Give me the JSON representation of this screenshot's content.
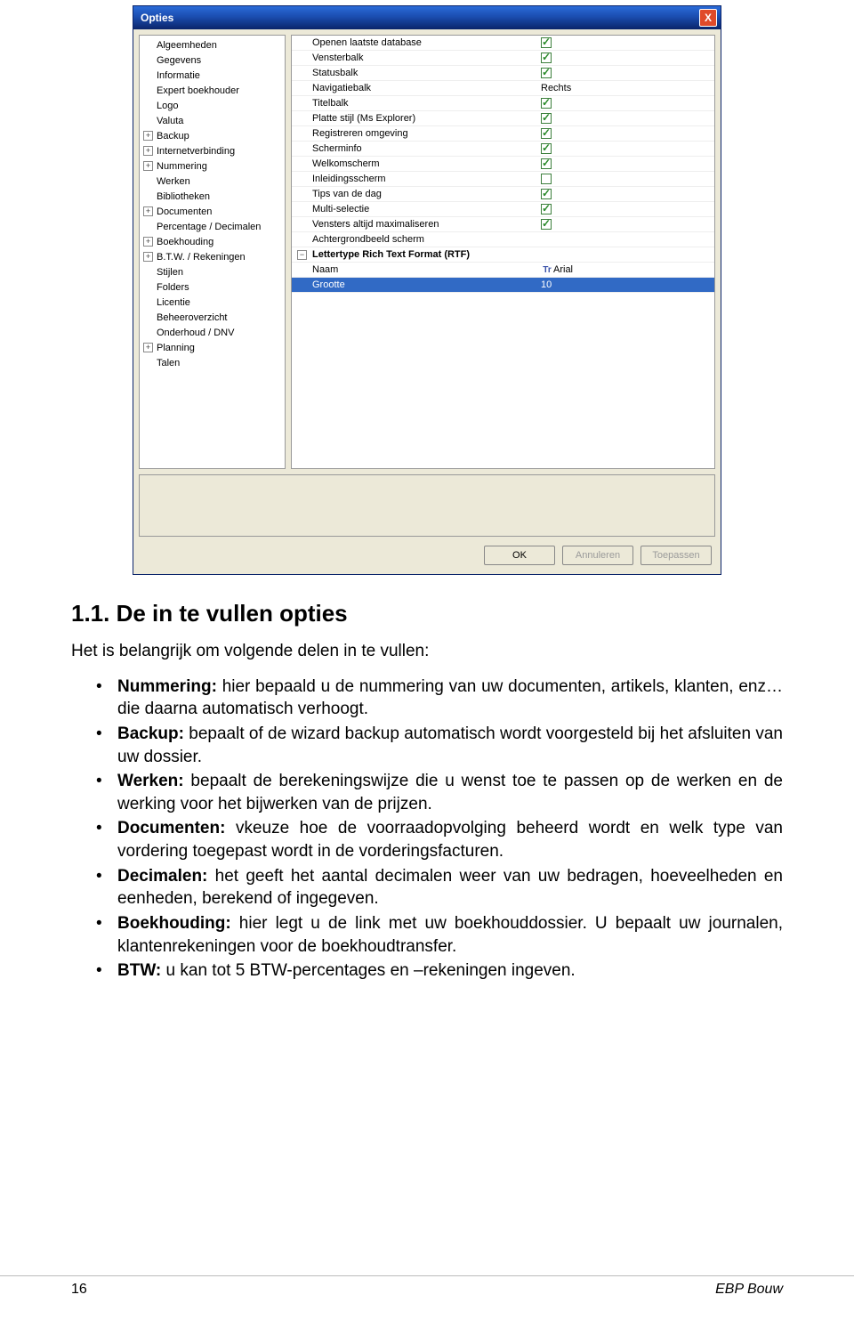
{
  "dialog": {
    "title": "Opties",
    "close": "X",
    "tree": [
      {
        "label": "Algeemheden",
        "expandable": false
      },
      {
        "label": "Gegevens",
        "expandable": false
      },
      {
        "label": "Informatie",
        "expandable": false
      },
      {
        "label": "Expert boekhouder",
        "expandable": false
      },
      {
        "label": "Logo",
        "expandable": false
      },
      {
        "label": "Valuta",
        "expandable": false
      },
      {
        "label": "Backup",
        "expandable": true
      },
      {
        "label": "Internetverbinding",
        "expandable": true
      },
      {
        "label": "Nummering",
        "expandable": true
      },
      {
        "label": "Werken",
        "expandable": false
      },
      {
        "label": "Bibliotheken",
        "expandable": false
      },
      {
        "label": "Documenten",
        "expandable": true
      },
      {
        "label": "Percentage / Decimalen",
        "expandable": false
      },
      {
        "label": "Boekhouding",
        "expandable": true
      },
      {
        "label": "B.T.W. / Rekeningen",
        "expandable": true
      },
      {
        "label": "Stijlen",
        "expandable": false
      },
      {
        "label": "Folders",
        "expandable": false
      },
      {
        "label": "Licentie",
        "expandable": false
      },
      {
        "label": "Beheeroverzicht",
        "expandable": false
      },
      {
        "label": "Onderhoud / DNV",
        "expandable": false
      },
      {
        "label": "Planning",
        "expandable": true
      },
      {
        "label": "Talen",
        "expandable": false
      }
    ],
    "grid": [
      {
        "name": "Openen laatste database",
        "type": "check",
        "checked": true
      },
      {
        "name": "Vensterbalk",
        "type": "check",
        "checked": true
      },
      {
        "name": "Statusbalk",
        "type": "check",
        "checked": true
      },
      {
        "name": "Navigatiebalk",
        "type": "text",
        "value": "Rechts"
      },
      {
        "name": "Titelbalk",
        "type": "check",
        "checked": true
      },
      {
        "name": "Platte stijl (Ms Explorer)",
        "type": "check",
        "checked": true
      },
      {
        "name": "Registreren omgeving",
        "type": "check",
        "checked": true
      },
      {
        "name": "Scherminfo",
        "type": "check",
        "checked": true
      },
      {
        "name": "Welkomscherm",
        "type": "check",
        "checked": true
      },
      {
        "name": "Inleidingsscherm",
        "type": "check",
        "checked": false
      },
      {
        "name": "Tips van de dag",
        "type": "check",
        "checked": true
      },
      {
        "name": "Multi-selectie",
        "type": "check",
        "checked": true
      },
      {
        "name": "Vensters altijd maximaliseren",
        "type": "check",
        "checked": true
      },
      {
        "name": "Achtergrondbeeld scherm",
        "type": "text",
        "value": ""
      }
    ],
    "group_header": "Lettertype Rich Text Format (RTF)",
    "font_rows": [
      {
        "name": "Naam",
        "value": "Arial",
        "icon": "Tr"
      },
      {
        "name": "Grootte",
        "value": "10",
        "selected": true
      }
    ],
    "buttons": {
      "ok": "OK",
      "cancel": "Annuleren",
      "apply": "Toepassen"
    }
  },
  "doc": {
    "heading": "1.1. De in te vullen opties",
    "intro": "Het is belangrijk om volgende delen in te vullen:",
    "bullets": [
      {
        "bold": "Nummering:",
        "text": " hier bepaald u de nummering van uw documenten, artikels, klanten, enz… die daarna automatisch verhoogt."
      },
      {
        "bold": "Backup:",
        "text": " bepaalt of de wizard backup automatisch wordt voorgesteld bij het afsluiten van uw dossier."
      },
      {
        "bold": "Werken:",
        "text": " bepaalt de berekeningswijze die u wenst toe te passen op de werken en de werking voor het bijwerken van de prijzen."
      },
      {
        "bold": "Documenten:",
        "text": " vkeuze hoe de voorraadopvolging beheerd wordt en welk type van vordering toegepast wordt in de vorderingsfacturen."
      },
      {
        "bold": "Decimalen:",
        "text": " het geeft het aantal decimalen weer van uw bedragen, hoeveelheden en eenheden, berekend of ingegeven."
      },
      {
        "bold": "Boekhouding:",
        "text": " hier legt u de link met uw boekhouddossier. U bepaalt uw journalen, klantenrekeningen voor de boekhoudtransfer."
      },
      {
        "bold": "BTW:",
        "text": " u kan tot  5 BTW-percentages en –rekeningen ingeven."
      }
    ]
  },
  "footer": {
    "page": "16",
    "brand": "EBP Bouw"
  }
}
